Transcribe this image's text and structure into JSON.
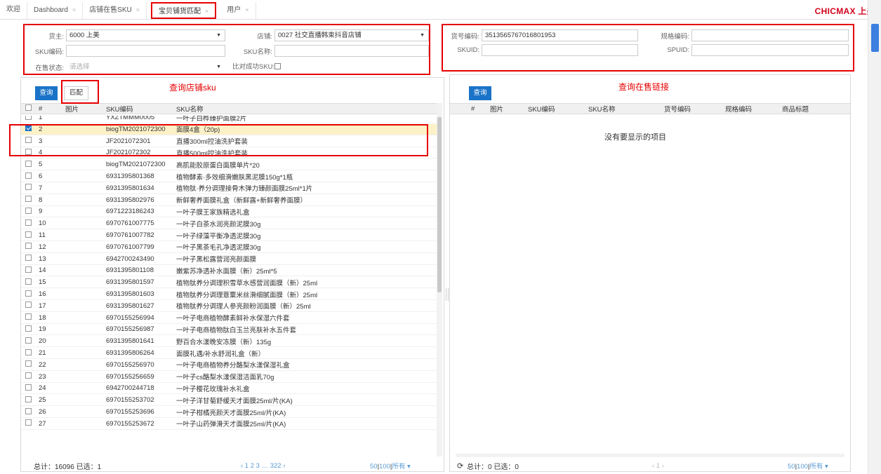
{
  "tabs": [
    {
      "label": "欢迎",
      "closable": false,
      "active": false
    },
    {
      "label": "Dashboard",
      "closable": true,
      "active": false
    },
    {
      "label": "店铺在售SKU",
      "closable": true,
      "active": false
    },
    {
      "label": "宝贝铺货匹配",
      "closable": true,
      "active": true
    },
    {
      "label": "用户",
      "closable": true,
      "active": false
    }
  ],
  "brand": "CHICMAX 上美",
  "close_glyph": "×",
  "left_form": {
    "owner_label": "货主:",
    "owner_value": "6000 上美",
    "store_label": "店铺:",
    "store_value": "0027 社交直播韩束抖音店铺",
    "sku_code_label": "SKU编码:",
    "sku_code_value": "",
    "sku_name_label": "SKU名称:",
    "sku_name_value": "",
    "status_label": "在售状态:",
    "status_placeholder": "请选择",
    "compare_label": "比对成功SKU:"
  },
  "right_form": {
    "goods_code_label": "货号编码:",
    "goods_code_value": "3513565767016801953",
    "spec_code_label": "规格编码:",
    "spec_code_value": "",
    "skuid_label": "SKUID:",
    "skuid_value": "",
    "spuid_label": "SPUID:",
    "spuid_value": ""
  },
  "left_panel": {
    "query_button": "查询",
    "match_button": "匹配",
    "annotation": "查询店铺sku",
    "columns": [
      "#",
      "图片",
      "SKU编码",
      "SKU名称"
    ],
    "rows": [
      {
        "num": "1",
        "code": "YXZTMMM0005",
        "name": "一叶子白桦臻护面膜2片",
        "checked": false
      },
      {
        "num": "2",
        "code": "biogTM2021072300",
        "name": "面膜4盒（20p)",
        "checked": true
      },
      {
        "num": "3",
        "code": "JF2021072301",
        "name": "直播300ml控油洗护套装",
        "checked": false
      },
      {
        "num": "4",
        "code": "JF2021072302",
        "name": "直播500ml控油洗护套装",
        "checked": false
      },
      {
        "num": "5",
        "code": "biogTM2021072300",
        "name": "高肌能胶原蛋白面膜单片*20",
        "checked": false
      },
      {
        "num": "6",
        "code": "6931395801368",
        "name": "植物酵素·多效细滑嫩肤黑泥膜150g*1瓶",
        "checked": false
      },
      {
        "num": "7",
        "code": "6931395801634",
        "name": "植物肽·养分调理接骨木弹力臻颜面膜25ml*1片",
        "checked": false
      },
      {
        "num": "8",
        "code": "6931395802976",
        "name": "新鲜奢养面膜礼盒（新鲜露+新鲜奢养面膜）",
        "checked": false
      },
      {
        "num": "9",
        "code": "6971223186243",
        "name": "一叶子膜王家族精选礼盒",
        "checked": false
      },
      {
        "num": "10",
        "code": "6970761007775",
        "name": "一叶子白茶水润亮颜泥膜30g",
        "checked": false
      },
      {
        "num": "11",
        "code": "6970761007782",
        "name": "一叶子绿藻平衡净透泥膜30g",
        "checked": false
      },
      {
        "num": "12",
        "code": "6970761007799",
        "name": "一叶子黑茶毛孔净透泥膜30g",
        "checked": false
      },
      {
        "num": "13",
        "code": "6942700243490",
        "name": "一叶子黑松露营润亮颜面膜",
        "checked": false
      },
      {
        "num": "14",
        "code": "6931395801108",
        "name": "嫩紫苏净透补水面膜（新）25ml*5",
        "checked": false
      },
      {
        "num": "15",
        "code": "6931395801597",
        "name": "植物肽养分调理积雪草水感营润面膜（新）25ml",
        "checked": false
      },
      {
        "num": "16",
        "code": "6931395801603",
        "name": "植物肽养分调理薏粟米丝滑细腻面膜（新）25ml",
        "checked": false
      },
      {
        "num": "17",
        "code": "6931395801627",
        "name": "植物肽养分调理人参亮颜粉润面膜（新）25ml",
        "checked": false
      },
      {
        "num": "18",
        "code": "6970155256994",
        "name": "一叶子电商植物酵素鲜补水保湿六件套",
        "checked": false
      },
      {
        "num": "19",
        "code": "6970155256987",
        "name": "一叶子电商植物肽白玉兰亮肤补水五件套",
        "checked": false
      },
      {
        "num": "20",
        "code": "6931395801641",
        "name": "野百合水漾晚安冻膜（新）135g",
        "checked": false
      },
      {
        "num": "21",
        "code": "6931395806264",
        "name": "面膜礼遇/补水舒润礼盒（新）",
        "checked": false
      },
      {
        "num": "22",
        "code": "6970155256970",
        "name": "一叶子电商植物养分酪梨水漾保湿礼盒",
        "checked": false
      },
      {
        "num": "23",
        "code": "6970155256659",
        "name": "一叶子cs酪梨水漾保湿洁面乳70g",
        "checked": false
      },
      {
        "num": "24",
        "code": "6942700244718",
        "name": "一叶子樱花玫瑰补水礼盒",
        "checked": false
      },
      {
        "num": "25",
        "code": "6970155253702",
        "name": "一叶子洋甘菊舒缓天才面膜25ml/片(KA)",
        "checked": false
      },
      {
        "num": "26",
        "code": "6970155253696",
        "name": "一叶子柑橘亮颜天才面膜25ml/片(KA)",
        "checked": false
      },
      {
        "num": "27",
        "code": "6970155253672",
        "name": "一叶子山药弹滑天才面膜25ml/片(KA)",
        "checked": false
      }
    ],
    "footer": {
      "summary": "总计：16096 已选：1",
      "pager": "‹ 1 2 3 … 322 ›",
      "size_a": "50",
      "size_b": "100",
      "size_c": "所有",
      "size_arrow": "▾"
    }
  },
  "right_panel": {
    "query_button": "查询",
    "annotation": "查询在售链接",
    "columns": [
      "#",
      "图片",
      "SKU编码",
      "SKU名称",
      "货号编码",
      "规格编码",
      "商品标题"
    ],
    "empty_text": "没有要显示的项目",
    "footer": {
      "summary": "总计：0 已选：0",
      "pager": "‹ 1 ›",
      "size_a": "50",
      "size_b": "100",
      "size_c": "所有",
      "size_arrow": "▾"
    }
  },
  "colors": {
    "accent": "#1a73c8",
    "highlight": "#e60000",
    "selected_row": "#fdf1c7",
    "brand": "#d0021b"
  }
}
